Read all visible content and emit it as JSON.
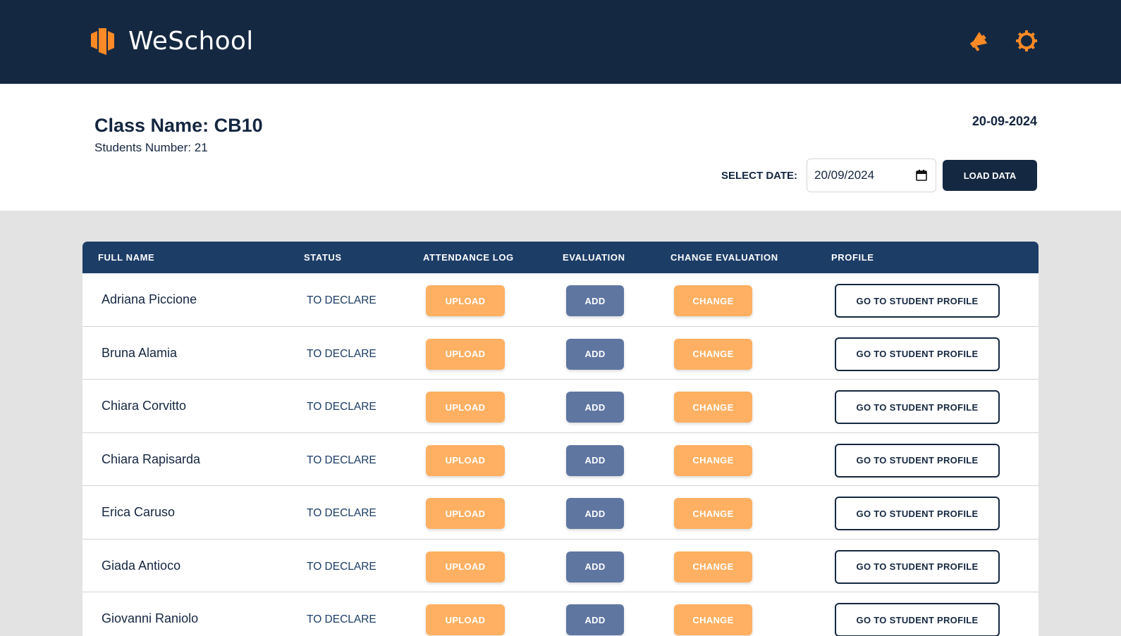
{
  "app": {
    "name": "WeSchool",
    "accent_color": "#ff8a26",
    "nav_color": "#152841"
  },
  "header": {
    "icons": [
      "megaphone-icon",
      "gear-icon"
    ]
  },
  "class_info": {
    "title": "Class Name: CB10",
    "students_number": "Students Number: 21",
    "current_date": "20-09-2024"
  },
  "date_picker": {
    "label": "SELECT DATE:",
    "value": "20/09/2024",
    "load_label": "LOAD DATA"
  },
  "table": {
    "headers": {
      "full_name": "FULL NAME",
      "status": "STATUS",
      "attendance_log": "ATTENDANCE LOG",
      "evaluation": "EVALUATION",
      "change_evaluation": "CHANGE EVALUATION",
      "profile": "PROFILE"
    },
    "rows": [
      {
        "name": "Adriana Piccione",
        "status": "TO DECLARE",
        "upload": "UPLOAD",
        "add": "ADD",
        "change": "CHANGE",
        "profile": "GO TO STUDENT PROFILE"
      },
      {
        "name": "Bruna Alamia",
        "status": "TO DECLARE",
        "upload": "UPLOAD",
        "add": "ADD",
        "change": "CHANGE",
        "profile": "GO TO STUDENT PROFILE"
      },
      {
        "name": "Chiara Corvitto",
        "status": "TO DECLARE",
        "upload": "UPLOAD",
        "add": "ADD",
        "change": "CHANGE",
        "profile": "GO TO STUDENT PROFILE"
      },
      {
        "name": "Chiara Rapisarda",
        "status": "TO DECLARE",
        "upload": "UPLOAD",
        "add": "ADD",
        "change": "CHANGE",
        "profile": "GO TO STUDENT PROFILE"
      },
      {
        "name": "Erica Caruso",
        "status": "TO DECLARE",
        "upload": "UPLOAD",
        "add": "ADD",
        "change": "CHANGE",
        "profile": "GO TO STUDENT PROFILE"
      },
      {
        "name": "Giada Antioco",
        "status": "TO DECLARE",
        "upload": "UPLOAD",
        "add": "ADD",
        "change": "CHANGE",
        "profile": "GO TO STUDENT PROFILE"
      },
      {
        "name": "Giovanni Raniolo",
        "status": "TO DECLARE",
        "upload": "UPLOAD",
        "add": "ADD",
        "change": "CHANGE",
        "profile": "GO TO STUDENT PROFILE"
      }
    ]
  }
}
